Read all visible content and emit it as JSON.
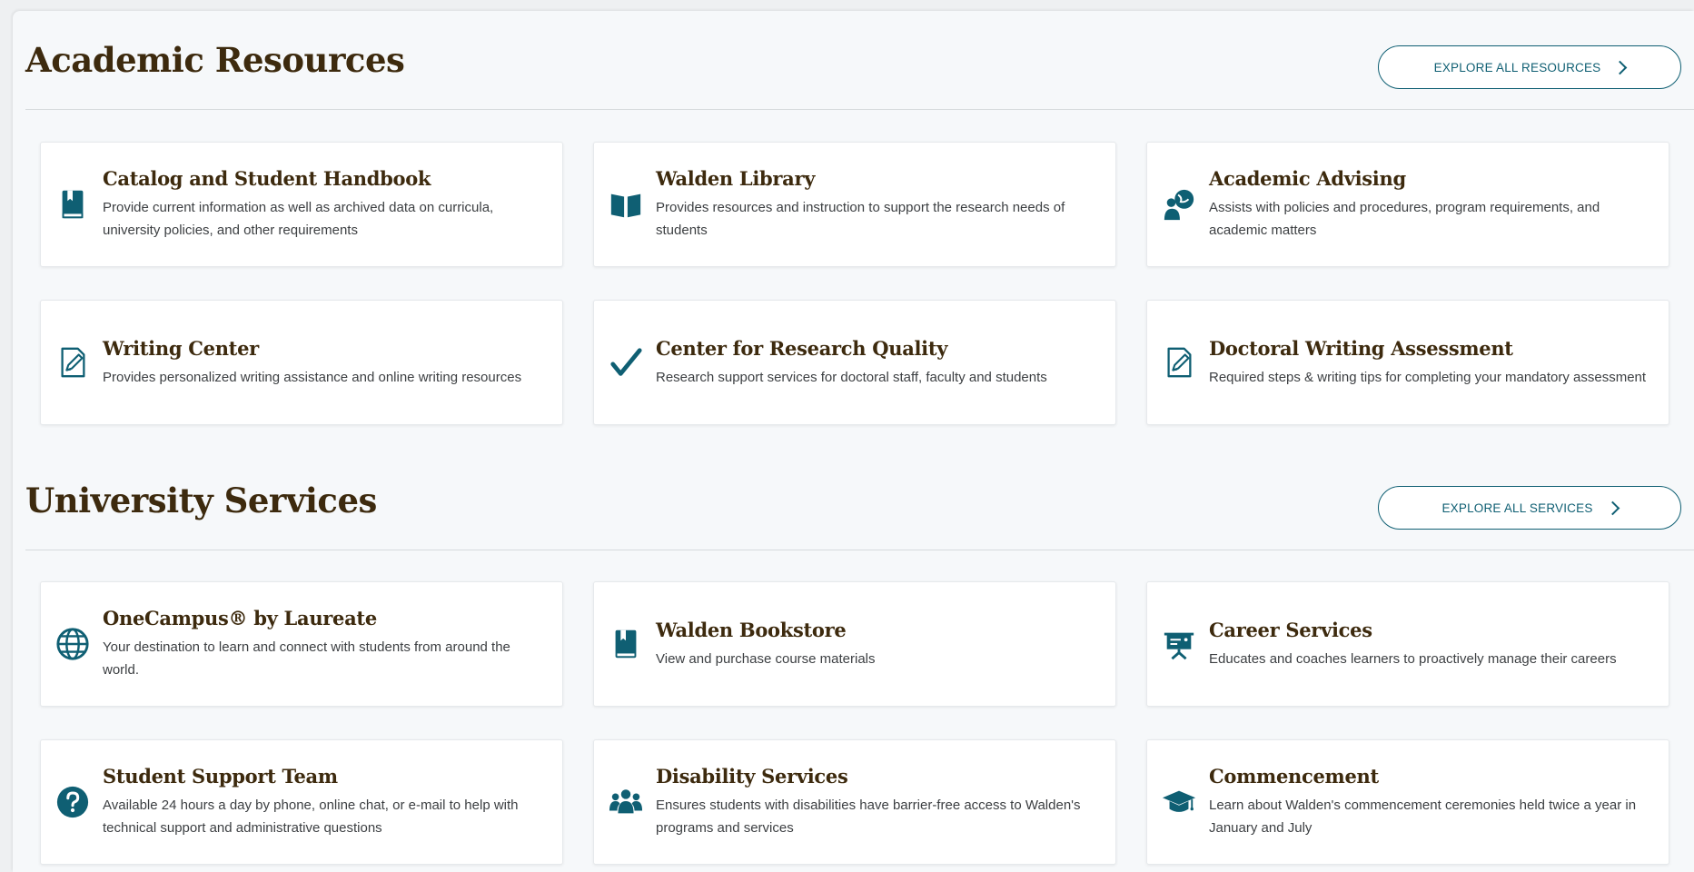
{
  "academic": {
    "title": "Academic Resources",
    "explore_label": "EXPLORE ALL RESOURCES",
    "cards": [
      {
        "title": "Catalog and Student Handbook",
        "desc": "Provide current information as well as archived data on curricula, university policies, and other requirements",
        "icon": "handbook-icon"
      },
      {
        "title": "Walden Library",
        "desc": "Provides resources and instruction to support the research needs of students",
        "icon": "open-book-icon"
      },
      {
        "title": "Academic Advising",
        "desc": "Assists with policies and procedures, program requirements, and academic matters",
        "icon": "advising-icon"
      },
      {
        "title": "Writing Center",
        "desc": "Provides personalized writing assistance and online writing resources",
        "icon": "edit-document-icon"
      },
      {
        "title": "Center for Research Quality",
        "desc": "Research support services for doctoral staff, faculty and students",
        "icon": "checkmark-icon"
      },
      {
        "title": "Doctoral Writing Assessment",
        "desc": "Required steps & writing tips for completing your mandatory assessment",
        "icon": "edit-document-icon"
      }
    ]
  },
  "services": {
    "title": "University Services",
    "explore_label": "EXPLORE ALL SERVICES",
    "cards": [
      {
        "title": "OneCampus® by Laureate",
        "desc": "Your destination to learn and connect with students from around the world.",
        "icon": "globe-icon"
      },
      {
        "title": "Walden Bookstore",
        "desc": "View and purchase course materials",
        "icon": "book-icon"
      },
      {
        "title": "Career Services",
        "desc": "Educates and coaches learners to proactively manage their careers",
        "icon": "presentation-icon"
      },
      {
        "title": "Student Support Team",
        "desc": "Available 24 hours a day by phone, online chat, or e-mail to help with technical support and administrative questions",
        "icon": "question-icon"
      },
      {
        "title": "Disability Services",
        "desc": "Ensures students with disabilities have barrier-free access to Walden's programs and services",
        "icon": "users-icon"
      },
      {
        "title": "Commencement",
        "desc": "Learn about Walden's commencement ceremonies held twice a year in January and July",
        "icon": "graduation-cap-icon"
      }
    ]
  },
  "colors": {
    "accent": "#0f5f73",
    "heading": "#3d2a0e",
    "text": "#3c3f42"
  }
}
